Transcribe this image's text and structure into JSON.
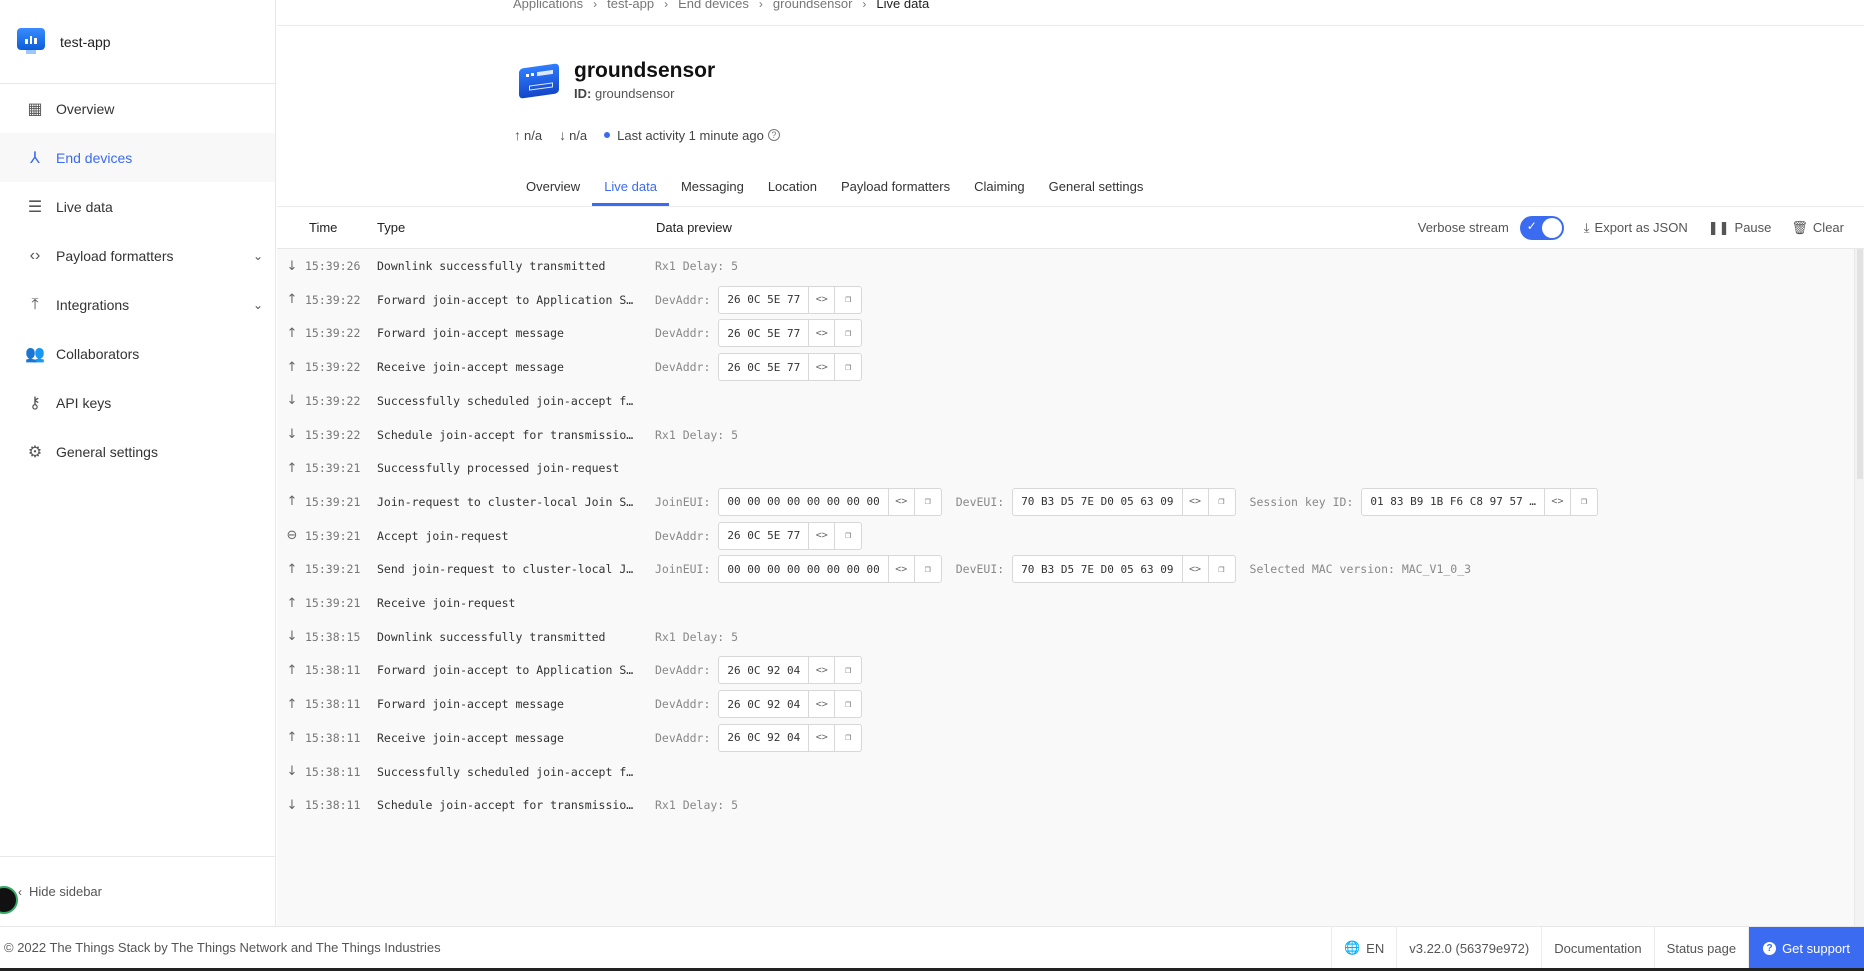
{
  "app": {
    "name": "test-app"
  },
  "sidebar": {
    "items": [
      {
        "label": "Overview",
        "icon": "dashboard-icon",
        "active": false,
        "expandable": false
      },
      {
        "label": "End devices",
        "icon": "device-tree-icon",
        "active": true,
        "expandable": false
      },
      {
        "label": "Live data",
        "icon": "list-monitor-icon",
        "active": false,
        "expandable": false
      },
      {
        "label": "Payload formatters",
        "icon": "code-icon",
        "active": false,
        "expandable": true
      },
      {
        "label": "Integrations",
        "icon": "merge-icon",
        "active": false,
        "expandable": true
      },
      {
        "label": "Collaborators",
        "icon": "people-icon",
        "active": false,
        "expandable": false
      },
      {
        "label": "API keys",
        "icon": "key-icon",
        "active": false,
        "expandable": false
      },
      {
        "label": "General settings",
        "icon": "gear-icon",
        "active": false,
        "expandable": false
      }
    ],
    "hide_label": "Hide sidebar"
  },
  "breadcrumb": [
    "Applications",
    "test-app",
    "End devices",
    "groundsensor",
    "Live data"
  ],
  "device": {
    "name": "groundsensor",
    "id_label": "ID:",
    "id_value": "groundsensor",
    "uplink": "n/a",
    "downlink": "n/a",
    "last_activity": "Last activity 1 minute ago"
  },
  "tabs": [
    {
      "label": "Overview",
      "active": false
    },
    {
      "label": "Live data",
      "active": true
    },
    {
      "label": "Messaging",
      "active": false
    },
    {
      "label": "Location",
      "active": false
    },
    {
      "label": "Payload formatters",
      "active": false
    },
    {
      "label": "Claiming",
      "active": false
    },
    {
      "label": "General settings",
      "active": false
    }
  ],
  "table": {
    "headers": {
      "time": "Time",
      "type": "Type",
      "preview": "Data preview"
    },
    "verbose_label": "Verbose stream",
    "verbose_on": true,
    "export_label": "Export as JSON",
    "pause_label": "Pause",
    "clear_label": "Clear"
  },
  "events": [
    {
      "dir": "down",
      "time": "15:39:26",
      "type": "Downlink successfully transmitted",
      "preview": [
        {
          "kind": "text",
          "text": "Rx1 Delay: 5"
        }
      ]
    },
    {
      "dir": "up",
      "time": "15:39:22",
      "type": "Forward join-accept to Application S…",
      "preview": [
        {
          "kind": "hex",
          "label": "DevAddr:",
          "value": "26 0C 5E 77"
        }
      ]
    },
    {
      "dir": "up",
      "time": "15:39:22",
      "type": "Forward join-accept message",
      "preview": [
        {
          "kind": "hex",
          "label": "DevAddr:",
          "value": "26 0C 5E 77"
        }
      ]
    },
    {
      "dir": "up",
      "time": "15:39:22",
      "type": "Receive join-accept message",
      "preview": [
        {
          "kind": "hex",
          "label": "DevAddr:",
          "value": "26 0C 5E 77"
        }
      ]
    },
    {
      "dir": "down",
      "time": "15:39:22",
      "type": "Successfully scheduled join-accept f…",
      "preview": []
    },
    {
      "dir": "down",
      "time": "15:39:22",
      "type": "Schedule join-accept for transmissio…",
      "preview": [
        {
          "kind": "text",
          "text": "Rx1 Delay: 5"
        }
      ]
    },
    {
      "dir": "up",
      "time": "15:39:21",
      "type": "Successfully processed join-request",
      "preview": []
    },
    {
      "dir": "up",
      "time": "15:39:21",
      "type": "Join-request to cluster-local Join S…",
      "preview": [
        {
          "kind": "hex",
          "label": "JoinEUI:",
          "value": "00 00 00 00 00 00 00 00"
        },
        {
          "kind": "hex",
          "label": "DevEUI:",
          "value": "70 B3 D5 7E D0 05 63 09"
        },
        {
          "kind": "hex",
          "label": "Session key ID:",
          "value": "01 83 B9 1B F6 C8 97 57 …"
        }
      ]
    },
    {
      "dir": "link",
      "time": "15:39:21",
      "type": "Accept join-request",
      "preview": [
        {
          "kind": "hex",
          "label": "DevAddr:",
          "value": "26 0C 5E 77"
        }
      ]
    },
    {
      "dir": "up",
      "time": "15:39:21",
      "type": "Send join-request to cluster-local J…",
      "preview": [
        {
          "kind": "hex",
          "label": "JoinEUI:",
          "value": "00 00 00 00 00 00 00 00"
        },
        {
          "kind": "hex",
          "label": "DevEUI:",
          "value": "70 B3 D5 7E D0 05 63 09"
        },
        {
          "kind": "text",
          "text": "Selected MAC version: MAC_V1_0_3"
        }
      ]
    },
    {
      "dir": "up",
      "time": "15:39:21",
      "type": "Receive join-request",
      "preview": []
    },
    {
      "dir": "down",
      "time": "15:38:15",
      "type": "Downlink successfully transmitted",
      "preview": [
        {
          "kind": "text",
          "text": "Rx1 Delay: 5"
        }
      ]
    },
    {
      "dir": "up",
      "time": "15:38:11",
      "type": "Forward join-accept to Application S…",
      "preview": [
        {
          "kind": "hex",
          "label": "DevAddr:",
          "value": "26 0C 92 04"
        }
      ]
    },
    {
      "dir": "up",
      "time": "15:38:11",
      "type": "Forward join-accept message",
      "preview": [
        {
          "kind": "hex",
          "label": "DevAddr:",
          "value": "26 0C 92 04"
        }
      ]
    },
    {
      "dir": "up",
      "time": "15:38:11",
      "type": "Receive join-accept message",
      "preview": [
        {
          "kind": "hex",
          "label": "DevAddr:",
          "value": "26 0C 92 04"
        }
      ]
    },
    {
      "dir": "down",
      "time": "15:38:11",
      "type": "Successfully scheduled join-accept f…",
      "preview": []
    },
    {
      "dir": "down",
      "time": "15:38:11",
      "type": "Schedule join-accept for transmissio…",
      "preview": [
        {
          "kind": "text",
          "text": "Rx1 Delay: 5"
        }
      ]
    }
  ],
  "footer": {
    "copyright": "© 2022 The Things Stack by The Things Network and The Things Industries",
    "language": "EN",
    "version": "v3.22.0 (56379e972)",
    "documentation": "Documentation",
    "status_page": "Status page",
    "support": "Get support"
  },
  "colors": {
    "accent": "#3b6bf0"
  }
}
